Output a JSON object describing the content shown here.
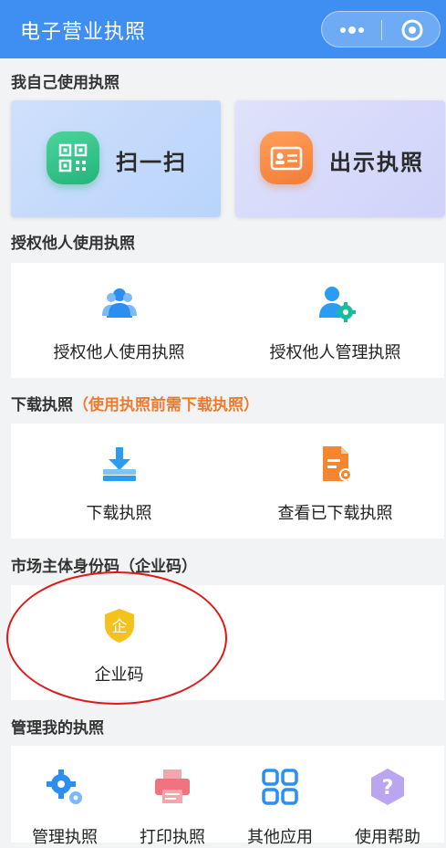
{
  "header": {
    "title": "电子营业执照",
    "more_icon": "more-dots-icon",
    "close_icon": "mini-program-close-icon"
  },
  "sections": {
    "self_use": "我自己使用执照",
    "authorize": "授权他人使用执照",
    "download": "下载执照",
    "download_note": "（使用执照前需下载执照）",
    "identity_code": "市场主体身份码（企业码）",
    "manage": "管理我的执照"
  },
  "self_use": {
    "scan_label": "扫一扫",
    "show_label": "出示执照"
  },
  "authorize": {
    "use_label": "授权他人使用执照",
    "manage_label": "授权他人管理执照"
  },
  "download": {
    "download_label": "下载执照",
    "view_label": "查看已下载执照"
  },
  "identity_code": {
    "enterprise_label": "企业码",
    "badge_char": "企"
  },
  "manage": {
    "items": [
      {
        "label": "管理执照",
        "icon": "gear-icon"
      },
      {
        "label": "打印执照",
        "icon": "printer-icon"
      },
      {
        "label": "其他应用",
        "icon": "grid-icon"
      },
      {
        "label": "使用帮助",
        "icon": "help-icon"
      }
    ]
  },
  "colors": {
    "header": "#3f8ff2",
    "accent_orange": "#ef7a2c",
    "icon_blue": "#2a8ff0",
    "annotation_red": "#e01818"
  }
}
